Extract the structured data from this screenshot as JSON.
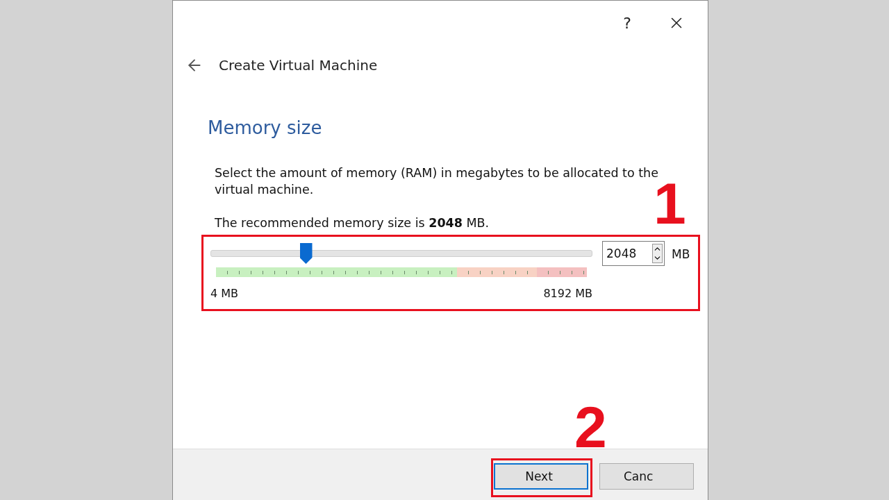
{
  "window": {
    "help": "?",
    "title": "Create Virtual Machine"
  },
  "page": {
    "heading": "Memory size",
    "description": "Select the amount of memory (RAM) in megabytes to be allocated to the virtual machine.",
    "recommendation": "The recommended memory size is **2048** MB."
  },
  "memory": {
    "level": 0.25,
    "value": "2048",
    "unit": "MB",
    "min_label": "4 MB",
    "max_label": "8192 MB"
  },
  "buttons": [
    {
      "label": "Next",
      "selected": true
    },
    {
      "label": "Canc",
      "selected": false
    }
  ],
  "annotations": [
    {
      "label": "1",
      "kind": "box"
    },
    {
      "label": "2",
      "kind": "button"
    }
  ]
}
